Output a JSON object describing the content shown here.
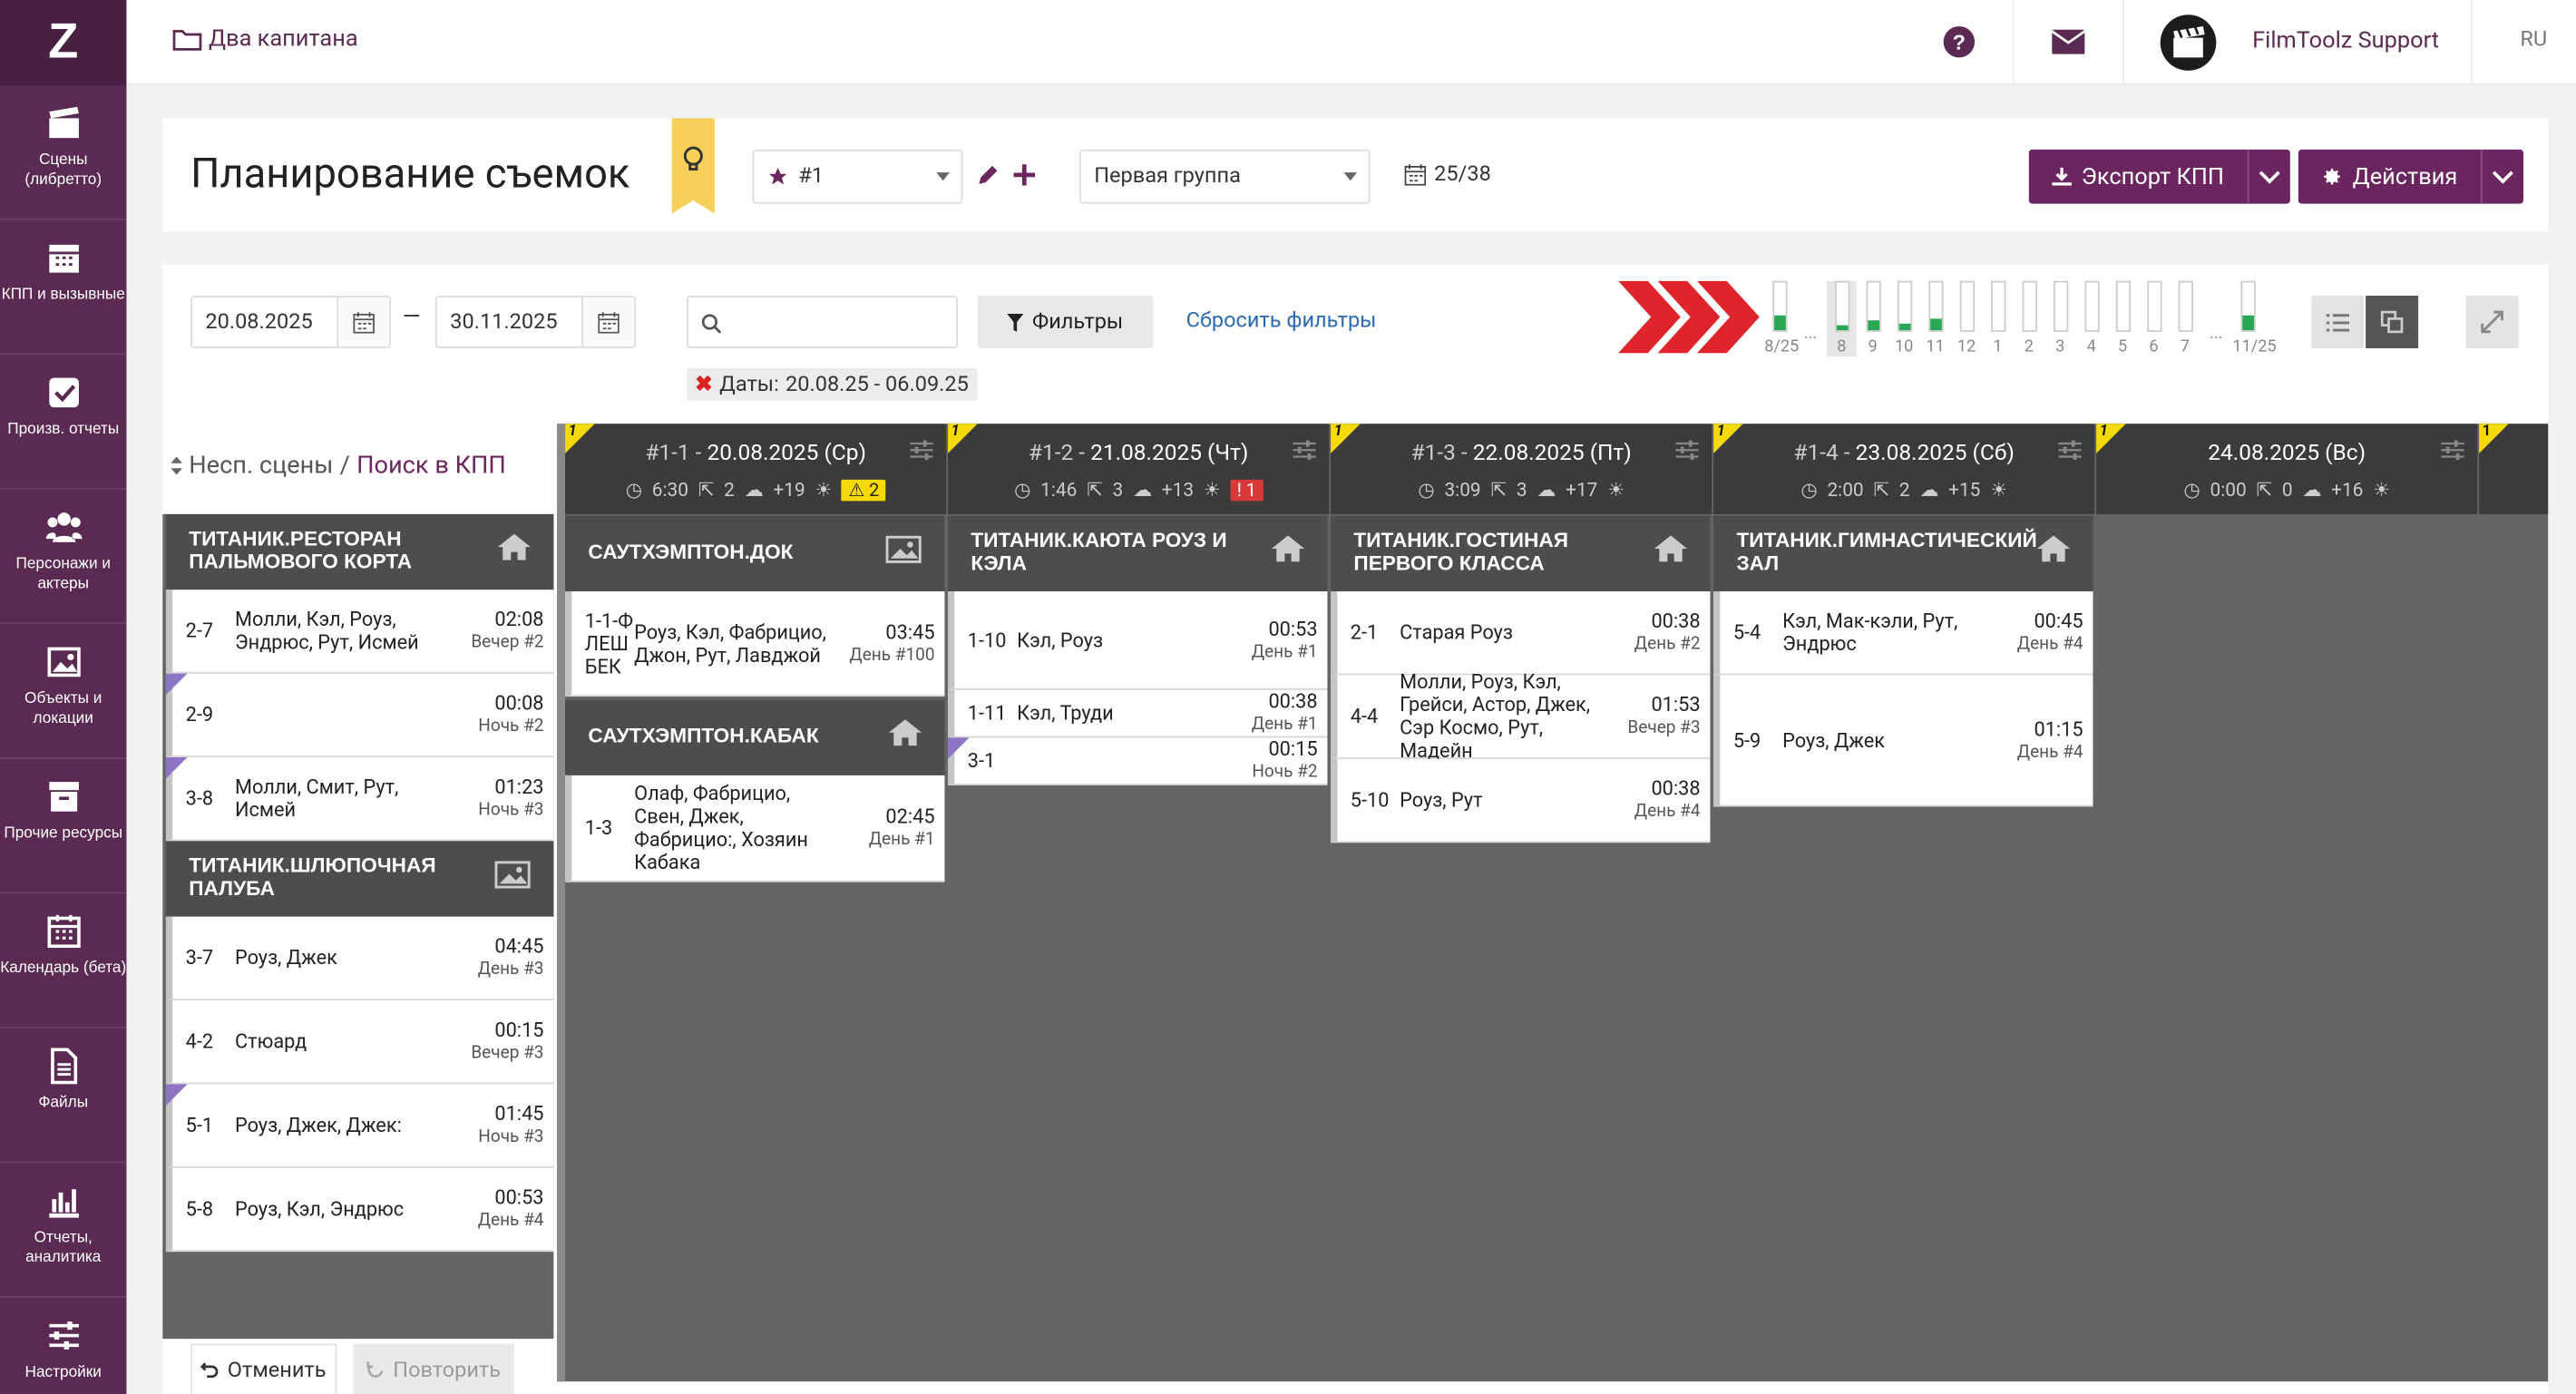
{
  "sidebar": {
    "items": [
      {
        "label": "Сцены (либретто)",
        "icon": "clapperboard-icon"
      },
      {
        "label": "КПП и вызывные",
        "icon": "calendar-grid-icon"
      },
      {
        "label": "Произв. отчеты",
        "icon": "checkbox-icon"
      },
      {
        "label": "Персонажи и актеры",
        "icon": "users-icon"
      },
      {
        "label": "Объекты и локации",
        "icon": "image-icon"
      },
      {
        "label": "Прочие ресурсы",
        "icon": "archive-box-icon"
      },
      {
        "label": "Календарь (бета)",
        "icon": "calendar-icon"
      },
      {
        "label": "Файлы",
        "icon": "file-icon"
      },
      {
        "label": "Отчеты, аналитика",
        "icon": "bar-chart-icon"
      },
      {
        "label": "Настройки",
        "icon": "sliders-icon"
      }
    ]
  },
  "topbar": {
    "project": "Два капитана",
    "user": "FilmToolz Support",
    "lang": "RU"
  },
  "header": {
    "title": "Планирование съемок",
    "version": "#1",
    "group": "Первая группа",
    "count": "25/38",
    "export_label": "Экспорт КПП",
    "actions_label": "Действия"
  },
  "filters": {
    "date_from": "20.08.2025",
    "date_to": "30.11.2025",
    "dash": "—",
    "search_placeholder": "",
    "filters_label": "Фильтры",
    "reset_label": "Сбросить фильтры",
    "chip_label": "Даты:",
    "chip_value": "20.08.25 - 06.09.25"
  },
  "timeline": {
    "labels": [
      "8/25",
      "...",
      "8",
      "9",
      "10",
      "11",
      "12",
      "1",
      "2",
      "3",
      "4",
      "5",
      "6",
      "7",
      "...",
      "11/25"
    ],
    "fills": [
      0.3,
      null,
      0.1,
      0.2,
      0.15,
      0.25,
      0,
      0,
      0,
      0,
      0,
      0,
      0,
      0,
      null,
      0.3
    ]
  },
  "left": {
    "label_unscheduled": "Несп. сцены",
    "slash": "/",
    "label_search": "Поиск в КПП",
    "undo": "Отменить",
    "redo": "Повторить",
    "groups": [
      {
        "title": "ТИТАНИК.РЕСТОРАН ПАЛЬМОВОГО КОРТА",
        "icon": "home-icon",
        "scenes": [
          {
            "num": "2-7",
            "cast": "Молли, Кэл, Роуз, Эндрюс, Рут, Исмей",
            "time": "02:08",
            "day": "Вечер #2",
            "mark": false
          },
          {
            "num": "2-9",
            "cast": "",
            "time": "00:08",
            "day": "Ночь #2",
            "mark": true
          },
          {
            "num": "3-8",
            "cast": "Молли, Смит, Рут, Исмей",
            "time": "01:23",
            "day": "Ночь #3",
            "mark": true
          }
        ]
      },
      {
        "title": "ТИТАНИК.ШЛЮПОЧНАЯ ПАЛУБА",
        "icon": "image-icon",
        "scenes": [
          {
            "num": "3-7",
            "cast": "Роуз, Джек",
            "time": "04:45",
            "day": "День #3",
            "mark": false
          },
          {
            "num": "4-2",
            "cast": "Стюард",
            "time": "00:15",
            "day": "Вечер #3",
            "mark": false
          },
          {
            "num": "5-1",
            "cast": "Роуз, Джек, Джек:",
            "time": "01:45",
            "day": "Ночь #3",
            "mark": true
          },
          {
            "num": "5-8",
            "cast": "Роуз, Кэл, Эндрюс",
            "time": "00:53",
            "day": "День #4",
            "mark": false
          }
        ]
      }
    ]
  },
  "days": [
    {
      "flag": "1",
      "id": "#1-1 -",
      "date": "20.08.2025 (Ср)",
      "dur": "6:30",
      "trans": "2",
      "weather": "+19",
      "badge": "2",
      "badge_type": "warn",
      "groups": [
        {
          "title": "САУТХЭМПТОН.ДОК",
          "icon": "image-icon",
          "scenes": [
            {
              "num": "1-1-Ф ЛЕШ БЕК",
              "cast": "Роуз, Кэл, Фабрицио, Джон, Рут, Лавджой",
              "time": "03:45",
              "day": "День #100",
              "mark": false
            }
          ]
        },
        {
          "title": "САУТХЭМПТОН.КАБАК",
          "icon": "home-icon",
          "scenes": [
            {
              "num": "1-3",
              "cast": "Олаф, Фабрицио, Свен, Джек, Фабрицио:, Хозяин Кабака",
              "time": "02:45",
              "day": "День #1",
              "mark": false
            }
          ]
        }
      ]
    },
    {
      "flag": "1",
      "id": "#1-2 -",
      "date": "21.08.2025 (Чт)",
      "dur": "1:46",
      "trans": "3",
      "weather": "+13",
      "badge": "1",
      "badge_type": "error",
      "groups": [
        {
          "title": "ТИТАНИК.КАЮТА РОУЗ И КЭЛА",
          "icon": "home-icon",
          "scenes": [
            {
              "num": "1-10",
              "cast": "Кэл, Роуз",
              "time": "00:53",
              "day": "День #1",
              "mark": false
            },
            {
              "num": "1-11",
              "cast": "Кэл, Труди",
              "time": "00:38",
              "day": "День #1",
              "mark": false
            },
            {
              "num": "3-1",
              "cast": "",
              "time": "00:15",
              "day": "Ночь #2",
              "mark": true
            }
          ]
        }
      ]
    },
    {
      "flag": "1",
      "id": "#1-3 -",
      "date": "22.08.2025 (Пт)",
      "dur": "3:09",
      "trans": "3",
      "weather": "+17",
      "badge": "",
      "badge_type": "",
      "groups": [
        {
          "title": "ТИТАНИК.ГОСТИНАЯ ПЕРВОГО КЛАССА",
          "icon": "home-icon",
          "scenes": [
            {
              "num": "2-1",
              "cast": "Старая Роуз",
              "time": "00:38",
              "day": "День #2",
              "mark": false
            },
            {
              "num": "4-4",
              "cast": "Молли, Роуз, Кэл, Грейси, Астор, Джек, Сэр Космо, Рут, Мадейн",
              "time": "01:53",
              "day": "Вечер #3",
              "mark": false
            },
            {
              "num": "5-10",
              "cast": "Роуз, Рут",
              "time": "00:38",
              "day": "День #4",
              "mark": false
            }
          ]
        }
      ]
    },
    {
      "flag": "1",
      "id": "#1-4 -",
      "date": "23.08.2025 (Сб)",
      "dur": "2:00",
      "trans": "2",
      "weather": "+15",
      "badge": "",
      "badge_type": "",
      "groups": [
        {
          "title": "ТИТАНИК.ГИМНАСТИЧЕСКИЙ ЗАЛ",
          "icon": "home-icon",
          "scenes": [
            {
              "num": "5-4",
              "cast": "Кэл, Мак-кэли, Рут, Эндрюс",
              "time": "00:45",
              "day": "День #4",
              "mark": false
            },
            {
              "num": "5-9",
              "cast": "Роуз, Джек",
              "time": "01:15",
              "day": "День #4",
              "mark": false
            }
          ]
        }
      ]
    },
    {
      "flag": "1",
      "id": "",
      "date": "24.08.2025 (Вс)",
      "dur": "0:00",
      "trans": "0",
      "weather": "+16",
      "badge": "",
      "badge_type": "",
      "groups": []
    }
  ],
  "board_end_flag": "1",
  "colors": {
    "sidebar": "#5a2a52",
    "accent": "#6b2660",
    "link": "#2a6ab3",
    "flag": "#f5d90a",
    "mark": "#8d74c4",
    "ok": "#2aa755",
    "warn": "#f5d90a",
    "error": "#d83a3a"
  }
}
